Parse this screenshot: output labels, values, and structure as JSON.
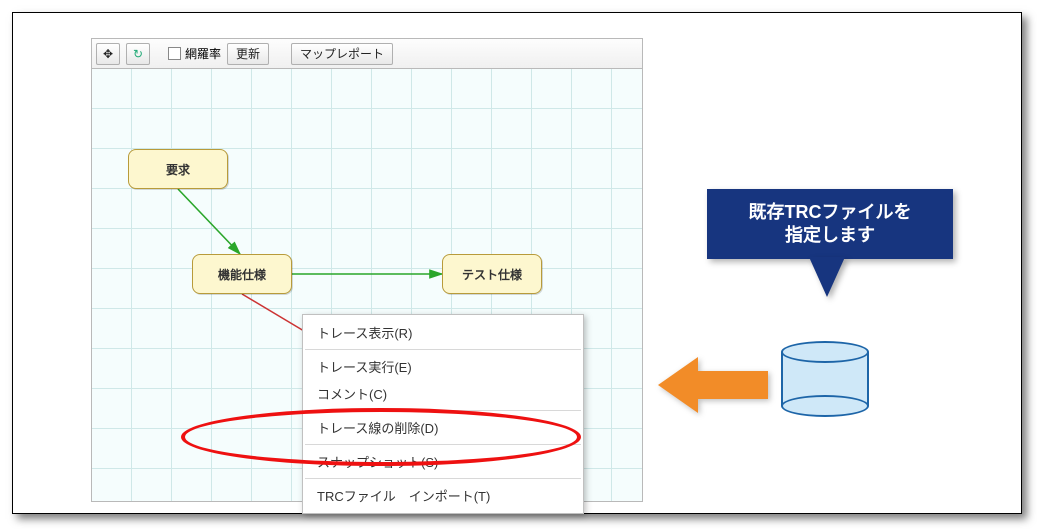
{
  "toolbar": {
    "move_icon": "✥",
    "refresh_icon": "↻",
    "coverage_label": "網羅率",
    "update_label": "更新",
    "map_report_label": "マップレポート"
  },
  "nodes": {
    "requirement": "要求",
    "func_spec": "機能仕様",
    "test_spec": "テスト仕様"
  },
  "context_menu": {
    "trace_view": "トレース表示(R)",
    "trace_run": "トレース実行(E)",
    "comment": "コメント(C)",
    "delete_trace": "トレース線の削除(D)",
    "snapshot": "スナップショット(S)",
    "trc_import": "TRCファイル　インポート(T)"
  },
  "callout": {
    "line1": "既存TRCファイルを",
    "line2": "指定します"
  }
}
